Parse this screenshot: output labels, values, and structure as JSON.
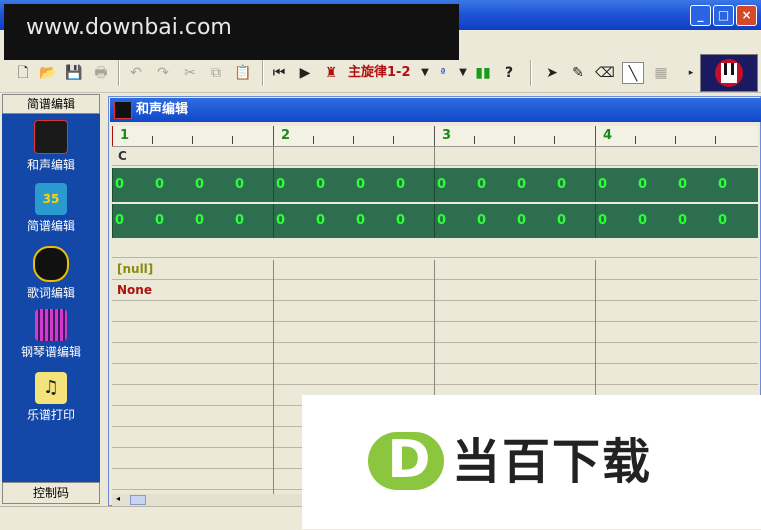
{
  "watermark": {
    "text": "www.downbai.com"
  },
  "window_buttons": {
    "minimize": "_",
    "maximize": "□",
    "close": "×"
  },
  "toolbar": {
    "melody_label": "主旋律1-2",
    "icons": [
      "new-file-icon",
      "open-folder-icon",
      "save-icon",
      "print-icon",
      "undo-icon",
      "redo-icon",
      "cut-icon",
      "copy-icon",
      "paste-icon",
      "skip-start-icon",
      "play-icon",
      "metronome-icon",
      "melody-dropdown",
      "note-icon",
      "level-bars-icon",
      "help-icon",
      "select-arrow-icon",
      "pencil-icon",
      "eraser-icon",
      "line-icon",
      "grid-icon"
    ]
  },
  "left_panel": {
    "top_tab": "简谱编辑",
    "bottom_tab": "控制码",
    "items": [
      {
        "label": "和声编辑",
        "icon": "harmony-icon"
      },
      {
        "label": "简谱编辑",
        "icon": "numbered-notation-icon"
      },
      {
        "label": "歌词编辑",
        "icon": "lyrics-icon"
      },
      {
        "label": "钢琴谱编辑",
        "icon": "piano-score-icon"
      },
      {
        "label": "乐谱打印",
        "icon": "score-print-icon"
      }
    ]
  },
  "editor": {
    "title": "和声编辑",
    "measures": [
      "1",
      "2",
      "3",
      "4"
    ],
    "chord": "C",
    "green_row_value": "0",
    "null_label": "[null]",
    "none_label": "None"
  },
  "brand": {
    "letter": "D",
    "text": "当百下载"
  }
}
